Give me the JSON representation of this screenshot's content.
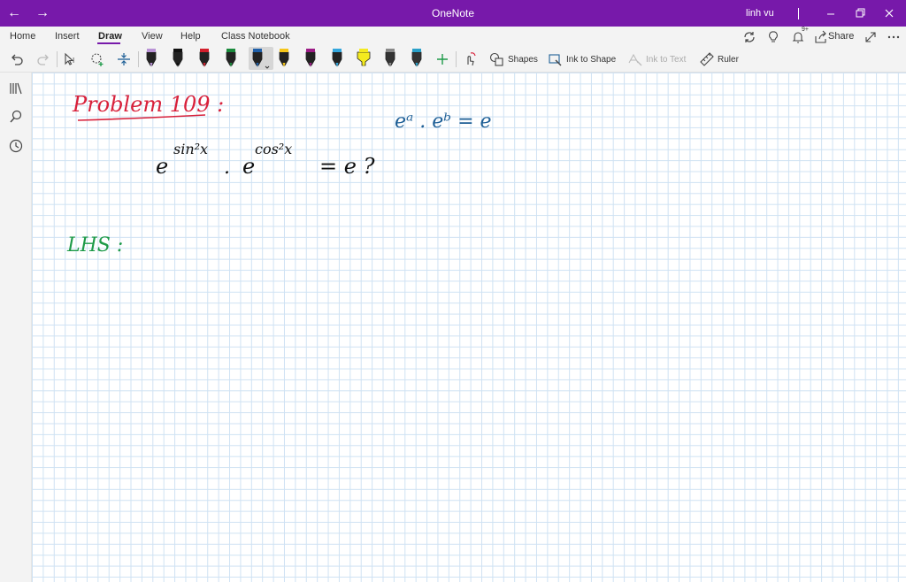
{
  "window": {
    "title": "OneNote",
    "user": "linh vu"
  },
  "tabs": [
    "Home",
    "Insert",
    "Draw",
    "View",
    "Help",
    "Class Notebook"
  ],
  "share_label": "Share",
  "notification_count": "9+",
  "ribbon": {
    "shapes_label": "Shapes",
    "ink_to_shape_label": "Ink to Shape",
    "ink_to_text_label": "Ink to Text",
    "ruler_label": "Ruler"
  },
  "pens": [
    {
      "color": "#b993d6",
      "kind": "pen"
    },
    {
      "color": "#111111",
      "kind": "pen"
    },
    {
      "color": "#d21f2c",
      "kind": "pen"
    },
    {
      "color": "#1a8a3c",
      "kind": "pen"
    },
    {
      "color": "#1f5fa8",
      "kind": "pen",
      "selected": true
    },
    {
      "color": "#f5c518",
      "kind": "pen"
    },
    {
      "color": "#9c1c86",
      "kind": "pen"
    },
    {
      "color": "#33a6dc",
      "kind": "pen"
    },
    {
      "color": "#f4ea1f",
      "kind": "highlighter"
    },
    {
      "color": "#888888",
      "kind": "pencil"
    },
    {
      "color": "#2aa0c8",
      "kind": "pencil"
    }
  ],
  "icons": {
    "back": "arrow-left-icon",
    "forward": "arrow-right-icon",
    "minimize": "minimize-icon",
    "restore": "restore-icon",
    "close": "close-icon",
    "sync": "sync-icon",
    "lightbulb": "lightbulb-icon",
    "bell": "bell-icon",
    "share": "share-icon",
    "expand": "expand-icon",
    "more": "more-icon",
    "undo": "undo-icon",
    "redo": "redo-icon",
    "lasso": "lasso-select-icon",
    "eraser": "add-space-icon",
    "insert_space": "insert-space-icon",
    "add_pen": "plus-icon",
    "touch_draw": "touch-draw-icon",
    "notebooks": "notebooks-icon",
    "search": "search-icon",
    "recent": "clock-icon"
  },
  "ink_colors": {
    "red": "#d8213b",
    "black": "#111111",
    "blue": "#1e5f96",
    "green": "#1d9a48"
  },
  "ink_text": {
    "problem": "Problem 109 :",
    "identity": "eᵃ . eᵇ = e",
    "equation_base1": "e",
    "equation_exp1": "sin²x",
    "dot": ".",
    "equation_base2": "e",
    "equation_exp2": "cos²x",
    "equals_part": "=  e   ?",
    "lhs": "LHS :"
  }
}
